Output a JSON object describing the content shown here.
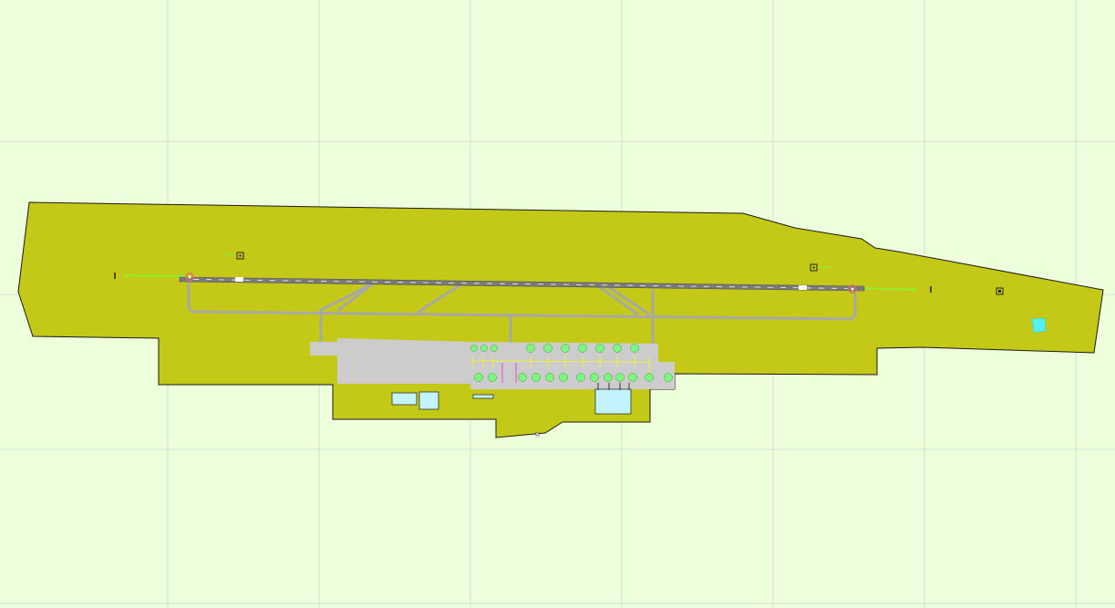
{
  "map": {
    "colors": {
      "background": "#eeffdb",
      "grid": "#cfe0d6",
      "airport_ground": "#c4c917",
      "outline": "#1a1a1a",
      "runway": "#7a7a7a",
      "taxiway": "#a8a8a8",
      "apron": "#cccccc",
      "building": "#c3f3ff",
      "water": "#55f0f0",
      "approach_lights": "#8cf02b",
      "stand": "#7dfa7d",
      "stand_line": "#f5ef3c",
      "marking": "#e060e0"
    },
    "features": [
      "airport-boundary",
      "runway",
      "taxiways",
      "apron",
      "aircraft-stands",
      "terminal-buildings",
      "approach-lights",
      "navaid-markers",
      "pond"
    ]
  }
}
